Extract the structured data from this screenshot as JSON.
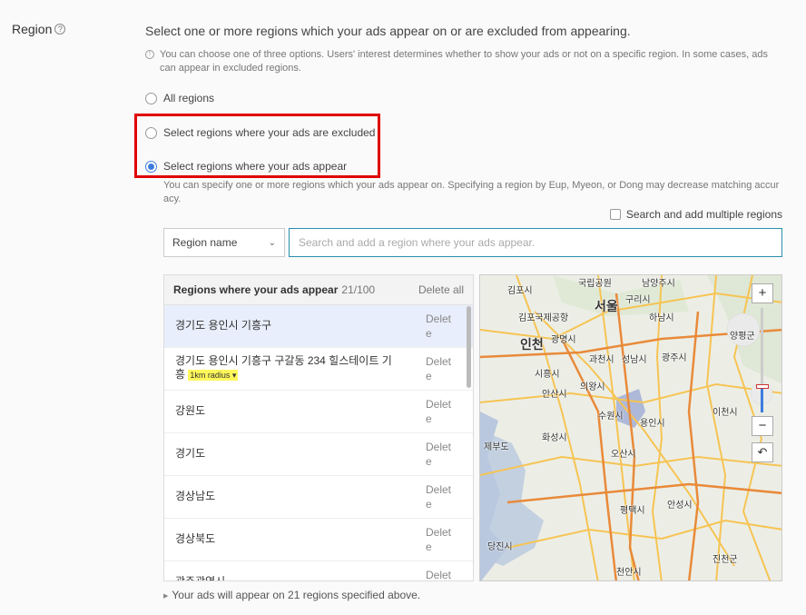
{
  "field_label": "Region",
  "headline": "Select one or more regions which your ads appear on or are excluded from appearing.",
  "info_text": "You can choose one of three options. Users' interest determines whether to show your ads or not on a specific region. In some cases, ads can appear in excluded regions.",
  "options": [
    {
      "label": "All regions",
      "checked": false
    },
    {
      "label": "Select regions where your ads are excluded",
      "checked": false
    },
    {
      "label": "Select regions where your ads appear",
      "checked": true
    }
  ],
  "appear_info": "You can specify one or more regions which your ads appear on. Specifying a region by Eup, Myeon, or Dong may decrease matching accuracy.",
  "multi_checkbox_label": "Search and add multiple regions",
  "select": {
    "value": "Region name"
  },
  "search": {
    "placeholder": "Search and add a region where your ads appear."
  },
  "list": {
    "title": "Regions where your ads appear",
    "count": "21/100",
    "delete_all": "Delete all",
    "delete_label": "Delete",
    "rows": [
      {
        "name": "경기도 용인시 기흥구",
        "selected": true
      },
      {
        "name": "경기도 용인시 기흥구 구갈동 234 힐스테이트 기흥",
        "radius": "1km radius ▾"
      },
      {
        "name": "강원도"
      },
      {
        "name": "경기도"
      },
      {
        "name": "경상남도"
      },
      {
        "name": "경상북도"
      },
      {
        "name": "광주광역시"
      }
    ]
  },
  "map": {
    "labels": {
      "seoul": "서울",
      "incheon": "인천",
      "gimpo": "김포시",
      "gimpo_airport": "김포국제공항",
      "guri": "구리시",
      "namyangju": "남양주시",
      "hanam": "하남시",
      "gwangmyeong": "광명시",
      "gwacheon": "과천시",
      "seongnam": "성남시",
      "gwangju": "광주시",
      "siheung": "시흥시",
      "uiwang": "의왕시",
      "ansan": "안산시",
      "suwon": "수원시",
      "yongin": "용인시",
      "icheon": "이천시",
      "hwaseong": "화성시",
      "osan": "오산시",
      "jebu": "제부도",
      "pyeongtaek": "평택시",
      "anseong": "안성시",
      "dangjin": "당진시",
      "cheonan": "천안시",
      "jincheon": "진천군",
      "yangpyeong": "양평군",
      "national": "국립공원"
    },
    "zoom_in": "+",
    "zoom_out": "−",
    "zoom_level": 0.25
  },
  "footer": "Your ads will appear on 21 regions specified above."
}
